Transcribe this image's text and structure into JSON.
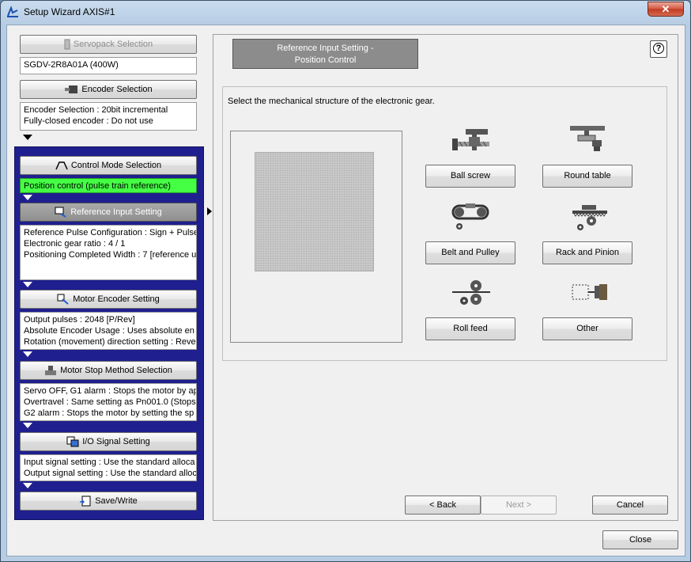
{
  "window": {
    "title": "Setup Wizard AXIS#1",
    "close_glyph": "✕"
  },
  "left": {
    "servopack": {
      "label": "Servopack Selection",
      "value": "SGDV-2R8A01A (400W)"
    },
    "encoder": {
      "label": "Encoder Selection",
      "lines": [
        "Encoder Selection : 20bit incremental",
        "Fully-closed encoder : Do not use"
      ]
    },
    "control_mode": {
      "label": "Control Mode Selection",
      "value": "Position control (pulse train reference)"
    },
    "reference_input": {
      "label": "Reference Input Setting",
      "lines": [
        "Reference Pulse Configuration : Sign + Pulse",
        "Electronic gear ratio : 4 / 1",
        "Positioning Completed Width : 7 [reference u"
      ]
    },
    "motor_encoder": {
      "label": "Motor Encoder Setting",
      "lines": [
        "Output pulses : 2048 [P/Rev]",
        "Absolute Encoder Usage : Uses absolute en",
        "Rotation (movement) direction setting : Reve"
      ]
    },
    "motor_stop": {
      "label": "Motor Stop Method Selection",
      "lines": [
        "Servo OFF, G1 alarm : Stops the motor by ap",
        "Overtravel : Same setting as Pn001.0 (Stops",
        "G2 alarm : Stops the motor by setting the sp"
      ]
    },
    "io_signal": {
      "label": "I/O Signal Setting",
      "lines": [
        "Input signal setting : Use the standard alloca",
        "Output signal setting : Use the standard alloc"
      ]
    },
    "save_write": {
      "label": "Save/Write"
    }
  },
  "right": {
    "header_line1": "Reference Input Setting -",
    "header_line2": "Position Control",
    "help_glyph": "?",
    "instruction": "Select the mechanical structure of the electronic gear.",
    "options": [
      "Ball screw",
      "Round table",
      "Belt and Pulley",
      "Rack and Pinion",
      "Roll feed",
      "Other"
    ]
  },
  "nav": {
    "back": "< Back",
    "next": "Next >",
    "cancel": "Cancel",
    "close": "Close"
  },
  "colors": {
    "active_green": "#44ff44",
    "panel_blue": "#1f1f8f"
  }
}
